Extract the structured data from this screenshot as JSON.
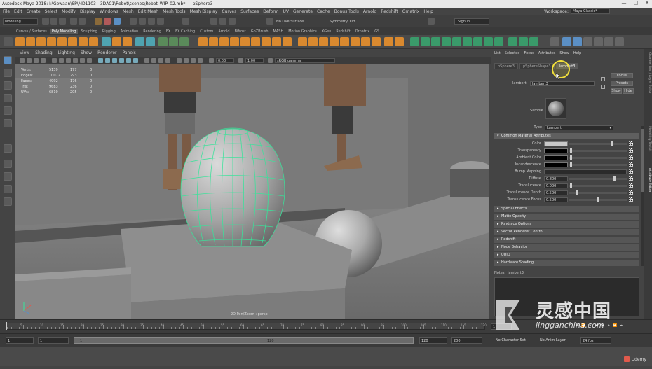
{
  "window": {
    "title": "Autodesk Maya 2018: I:\\Gewaan\\SP\\MD1103 - 3DAC1\\Robot\\scenes\\Robot_WIP_02.mb* --- pSphere3",
    "controls": [
      "—",
      "□",
      "✕"
    ]
  },
  "menubar": {
    "items": [
      "File",
      "Edit",
      "Create",
      "Select",
      "Modify",
      "Display",
      "Windows",
      "Mesh",
      "Edit Mesh",
      "Mesh Tools",
      "Mesh Display",
      "Curves",
      "Surfaces",
      "Deform",
      "UV",
      "Generate",
      "Cache",
      "Bonus Tools",
      "Arnold",
      "Redshift",
      "Ornatrix",
      "Help"
    ],
    "workspace_label": "Workspace:",
    "workspace_value": "Maya Classic*"
  },
  "statusline": {
    "mode": "Modeling",
    "live_surface": "No Live Surface",
    "symmetry": "Symmetry: Off",
    "sign_in": "Sign In"
  },
  "shelf_tabs": [
    "Curves / Surfaces",
    "Poly Modeling",
    "Sculpting",
    "Rigging",
    "Animation",
    "Rendering",
    "FX",
    "FX Caching",
    "Custom",
    "Arnold",
    "Bifrost",
    "GoZBrush",
    "MASH",
    "Motion Graphics",
    "XGen",
    "Redshift",
    "Ornatrix",
    "GS"
  ],
  "shelf_active": "Poly Modeling",
  "panel_menu": [
    "View",
    "Shading",
    "Lighting",
    "Show",
    "Renderer",
    "Panels"
  ],
  "viewport_tools": {
    "value_a": "0.00",
    "value_b": "1.00",
    "color_space": "sRGB gamma"
  },
  "hud": [
    {
      "label": "Verts:",
      "a": "5139",
      "b": "177",
      "c": "0"
    },
    {
      "label": "Edges:",
      "a": "10072",
      "b": "293",
      "c": "0"
    },
    {
      "label": "Faces:",
      "a": "4992",
      "b": "176",
      "c": "0"
    },
    {
      "label": "Tris:",
      "a": "9683",
      "b": "236",
      "c": "0"
    },
    {
      "label": "UVs:",
      "a": "6810",
      "b": "205",
      "c": "0"
    }
  ],
  "camera_label": "2D Pan/Zoom : persp",
  "attribute_editor": {
    "menu": [
      "List",
      "Selected",
      "Focus",
      "Attributes",
      "Show",
      "Help"
    ],
    "tabs": [
      "pSphere3",
      "pSphereShape3",
      "lambert3"
    ],
    "active_tab": "lambert3",
    "node_label": "lambert:",
    "node_value": "lambert3",
    "focus": "Focus",
    "presets": "Presets",
    "show": "Show",
    "hide": "Hide",
    "sample_label": "Sample",
    "type_label": "Type",
    "type_value": "Lambert",
    "common_section": "Common Material Attributes",
    "attrs": [
      {
        "label": "Color",
        "kind": "color",
        "value": "#c8c8c8"
      },
      {
        "label": "Transparency",
        "kind": "color",
        "value": "#000000"
      },
      {
        "label": "Ambient Color",
        "kind": "color",
        "value": "#000000"
      },
      {
        "label": "Incandescence",
        "kind": "color",
        "value": "#000000"
      },
      {
        "label": "Bump Mapping",
        "kind": "empty",
        "value": ""
      },
      {
        "label": "Diffuse",
        "kind": "num",
        "value": "0.800",
        "level": 0.8
      },
      {
        "label": "Translucence",
        "kind": "num",
        "value": "0.000",
        "level": 0.0
      },
      {
        "label": "Translucence Depth",
        "kind": "num",
        "value": "0.500",
        "level": 0.1
      },
      {
        "label": "Translucence Focus",
        "kind": "num",
        "value": "0.500",
        "level": 0.5
      }
    ],
    "sections": [
      "Special Effects",
      "Matte Opacity",
      "Raytrace Options",
      "Vector Renderer Control",
      "Redshift",
      "Node Behavior",
      "UUID",
      "Hardware Shading"
    ],
    "notes_label": "Notes:",
    "notes_value": "lambert3"
  },
  "right_strip_tabs": [
    "Channel Box / Layer Editor",
    "Modeling Toolkit",
    "Attribute Editor"
  ],
  "timeline": {
    "ticks": [
      "5",
      "10",
      "15",
      "20",
      "25",
      "30",
      "35",
      "40",
      "45",
      "50",
      "55",
      "60",
      "65",
      "70",
      "75",
      "80",
      "85",
      "90",
      "95",
      "100",
      "105",
      "110",
      "115",
      "120"
    ],
    "current": "1"
  },
  "range": {
    "start": "1",
    "current": "1",
    "bar_start": "1",
    "bar_end": "120",
    "end": "120",
    "max": "200",
    "character_set": "No Character Set",
    "anim_layer": "No Anim Layer",
    "fps": "24 fps"
  },
  "udemy": "Udemy",
  "watermark": {
    "cn": "灵感中国",
    "url": "lingganchina.com"
  },
  "colors": {
    "accent_blue": "#5b8fc4",
    "wireframe": "#39e39a",
    "cursor_ring": "#f2e03a",
    "maya_logo": "#3fb3c4"
  }
}
